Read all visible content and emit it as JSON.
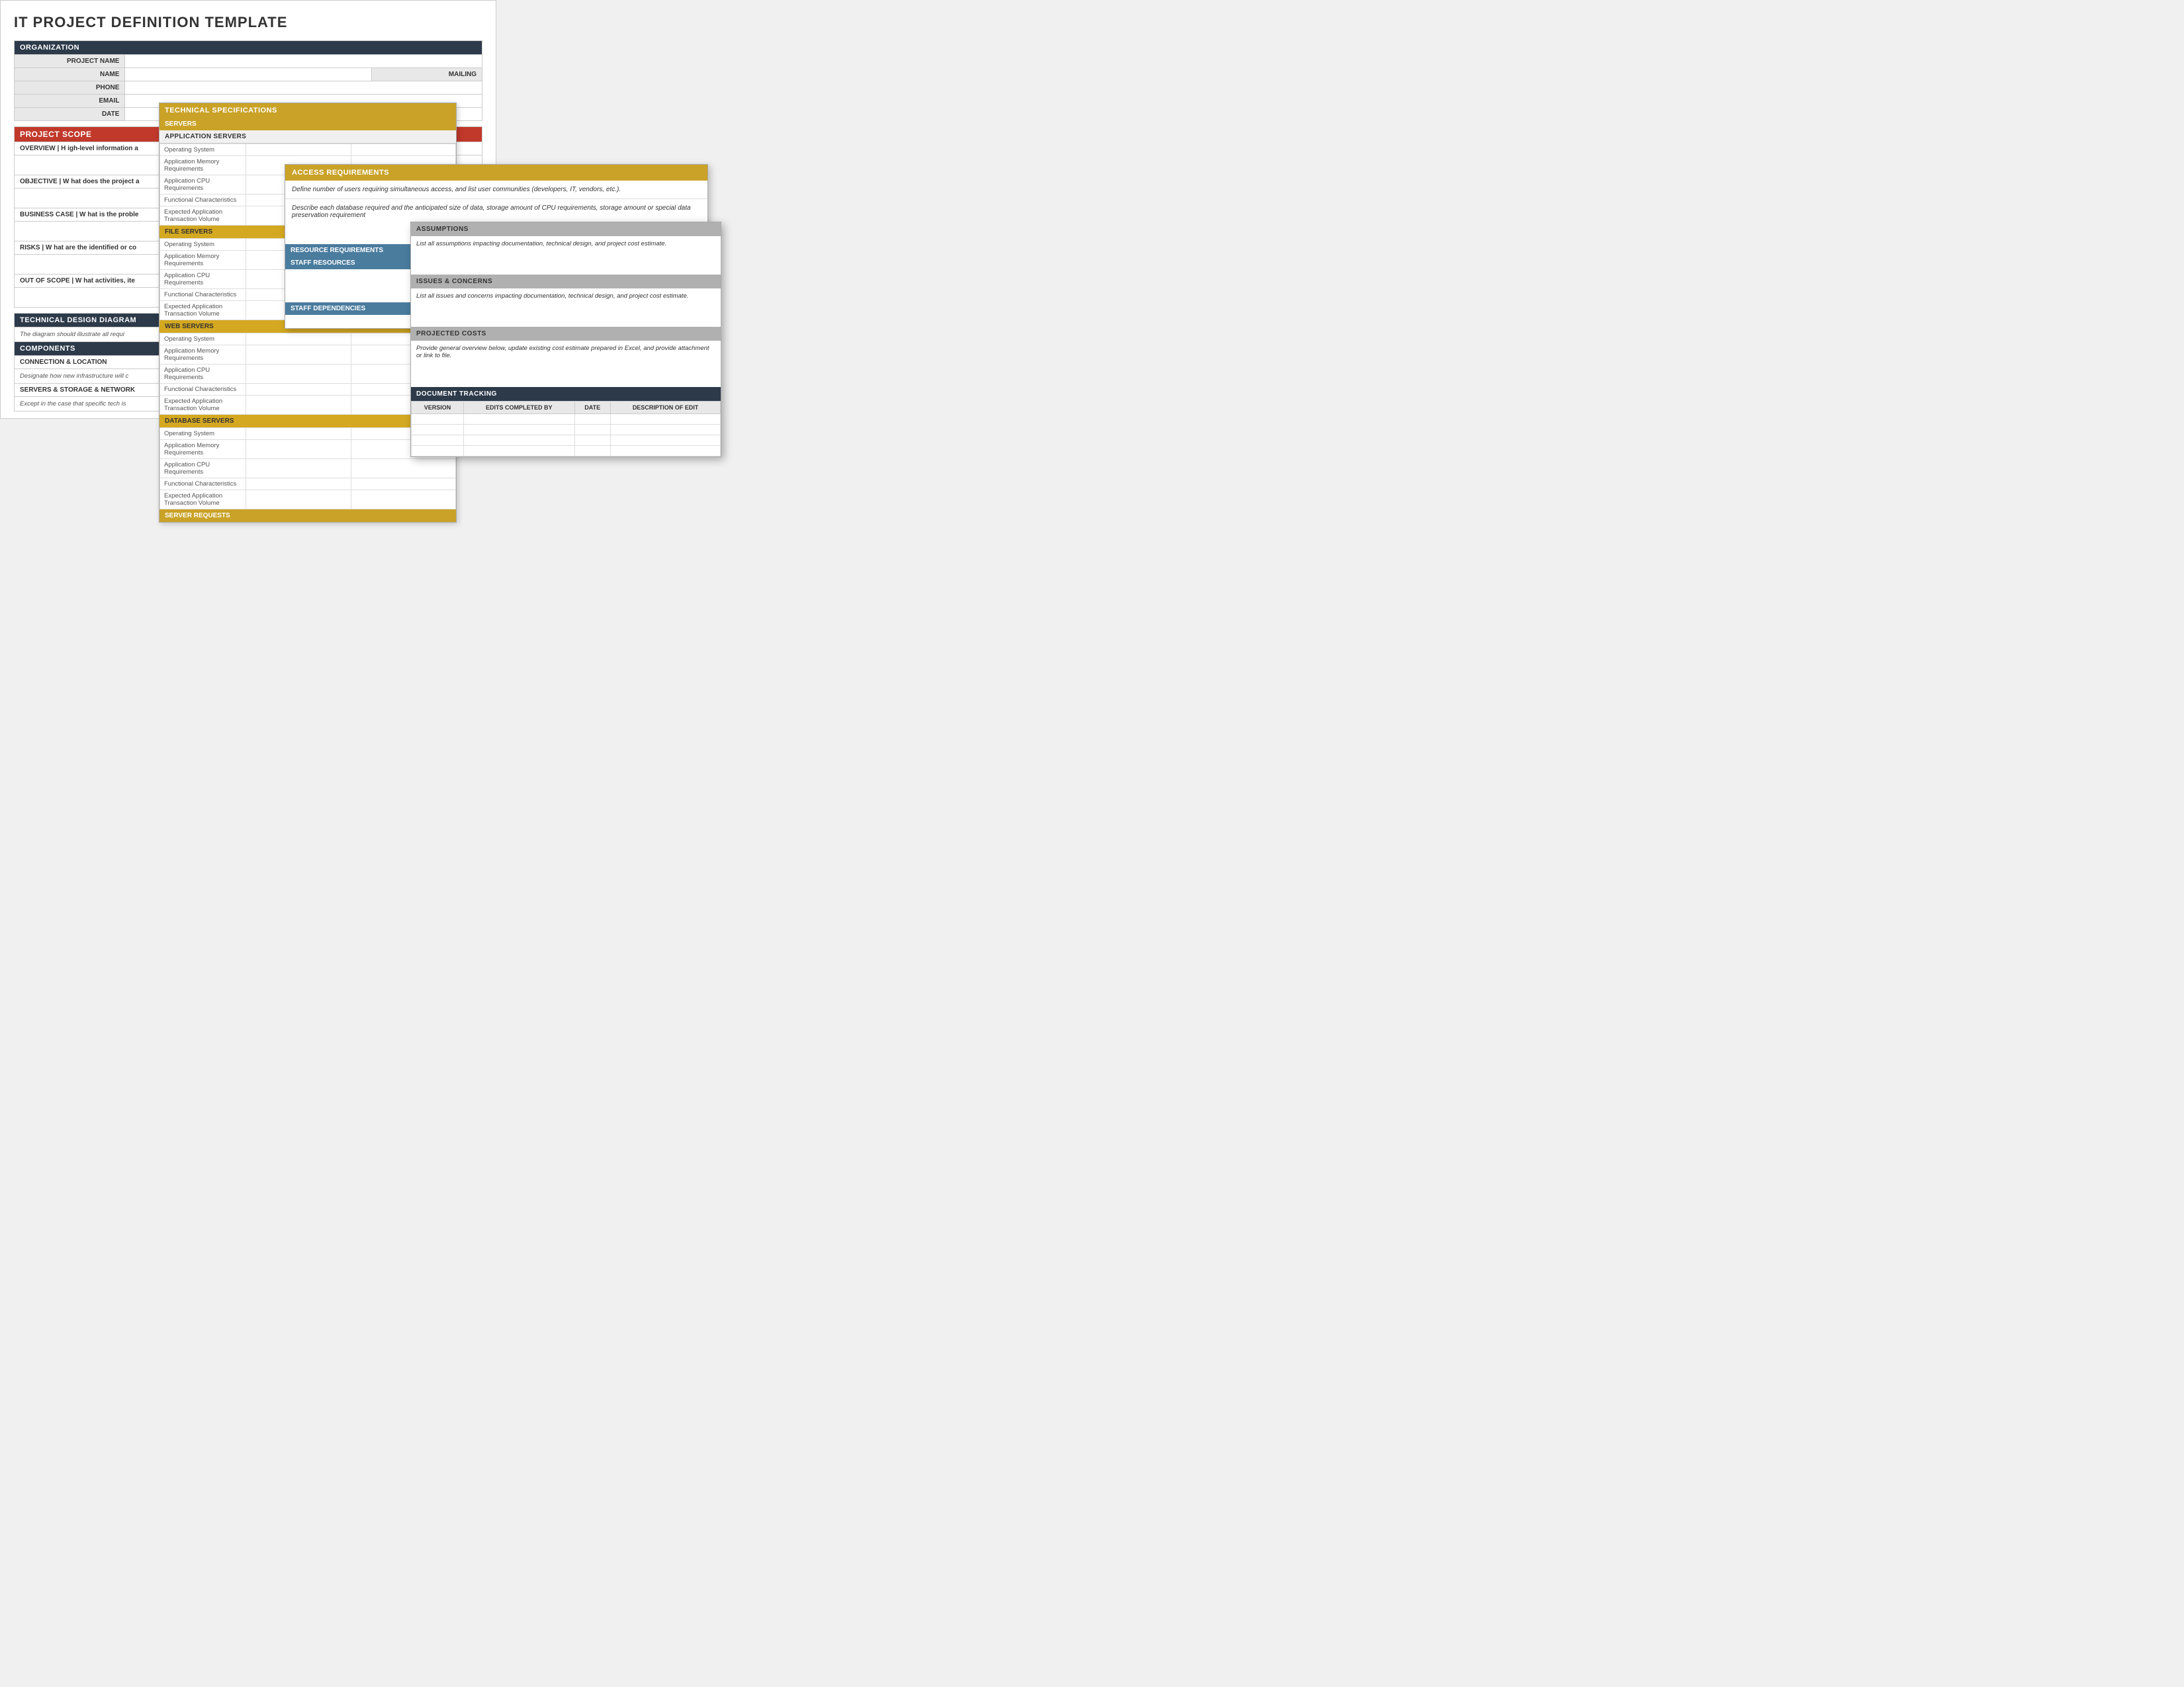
{
  "page_title": "IT PROJECT DEFINITION TEMPLATE",
  "main_doc": {
    "title": "IT PROJECT DEFINITION TEMPLATE",
    "org_label": "ORGANIZATION",
    "project_name_label": "PROJECT NAME",
    "name_label": "NAME",
    "mailing_label": "MAILING",
    "phone_label": "PHONE",
    "email_label": "EMAIL",
    "date_label": "DATE",
    "project_scope": "PROJECT SCOPE",
    "overview_label": "OVERVIEW  |  H igh-level information a",
    "objective_label": "OBJECTIVE  |  W hat does the project a",
    "business_case_label": "BUSINESS CASE  |  W hat is the proble",
    "risks_label": "RISKS  |  W hat are the identified or co",
    "out_of_scope_label": "OUT OF SCOPE  |  W hat activities, ite",
    "tech_design": "TECHNICAL DESIGN DIAGRAM",
    "tech_design_desc": "The diagram should illustrate all requi",
    "components": "COMPONENTS",
    "connection": "CONNECTION & LOCATION",
    "connection_desc": "Designate how new infrastructure will c",
    "servers": "SERVERS & STORAGE & NETWORK",
    "servers_desc": "Except in the case that specific tech is"
  },
  "tech_specs": {
    "header": "TECHNICAL SPECIFICATIONS",
    "servers": "SERVERS",
    "app_servers": "APPLICATION SERVERS",
    "items": [
      "Operating System",
      "Application Memory Requirements",
      "Application CPU Requirements",
      "Functional Characteristics",
      "Expected Application Transaction Volume"
    ],
    "file_servers": "FILE SERVERS",
    "web_servers": "WEB SERVERS",
    "db_servers": "DATABASE SERVERS",
    "server_requests": "SERVER REQUESTS"
  },
  "access_req": {
    "header": "ACCESS REQUIREMENTS",
    "desc": "Define number of users requiring simultaneous access, and list user communities (developers, IT, vendors, etc.).",
    "db_desc": "Describe each database required and the anticipated size of data, storage amount of CPU requirements, storage amount or special data preservation requirement",
    "resource_req": "RESOURCE REQUIREMENTS",
    "staff_resources": "STAFF RESOURCES",
    "staff_dep": "STAFF DEPENDENCIES"
  },
  "assumptions_doc": {
    "assumptions_header": "ASSUMPTIONS",
    "assumptions_desc": "List all assumptions impacting documentation, technical design, and project cost estimate.",
    "issues_header": "ISSUES & CONCERNS",
    "issues_desc": "List all issues and concerns impacting documentation, technical design, and project cost estimate.",
    "costs_header": "PROJECTED COSTS",
    "costs_desc": "Provide general overview below, update existing cost estimate prepared in Excel, and provide attachment or link to file.",
    "tracking_header": "DOCUMENT TRACKING",
    "tracking_cols": [
      "VERSION",
      "EDITS COMPLETED BY",
      "DATE",
      "DESCRIPTION OF EDIT"
    ]
  }
}
